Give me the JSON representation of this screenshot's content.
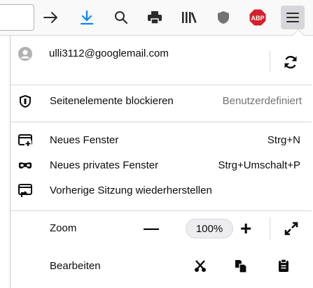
{
  "toolbar": {
    "buttons": [
      {
        "name": "forward-arrow-icon"
      },
      {
        "name": "download-icon"
      },
      {
        "name": "search-icon"
      },
      {
        "name": "print-icon"
      },
      {
        "name": "library-icon"
      },
      {
        "name": "shield-icon"
      },
      {
        "name": "adblock-icon",
        "text": "ABP"
      },
      {
        "name": "hamburger-menu-icon"
      }
    ]
  },
  "menu": {
    "account_email": "ulli3112@googlemail.com",
    "content_blocking_label": "Seitenelemente blockieren",
    "content_blocking_value": "Benutzerdefiniert",
    "new_window_label": "Neues Fenster",
    "new_window_shortcut": "Strg+N",
    "private_window_label": "Neues privates Fenster",
    "private_window_shortcut": "Strg+Umschalt+P",
    "restore_session_label": "Vorherige Sitzung wiederherstellen",
    "zoom_label": "Zoom",
    "zoom_out_symbol": "—",
    "zoom_value": "100%",
    "zoom_in_symbol": "+",
    "edit_label": "Bearbeiten"
  },
  "colors": {
    "download_blue": "#0a84ff",
    "abp_red": "#d3212d"
  }
}
